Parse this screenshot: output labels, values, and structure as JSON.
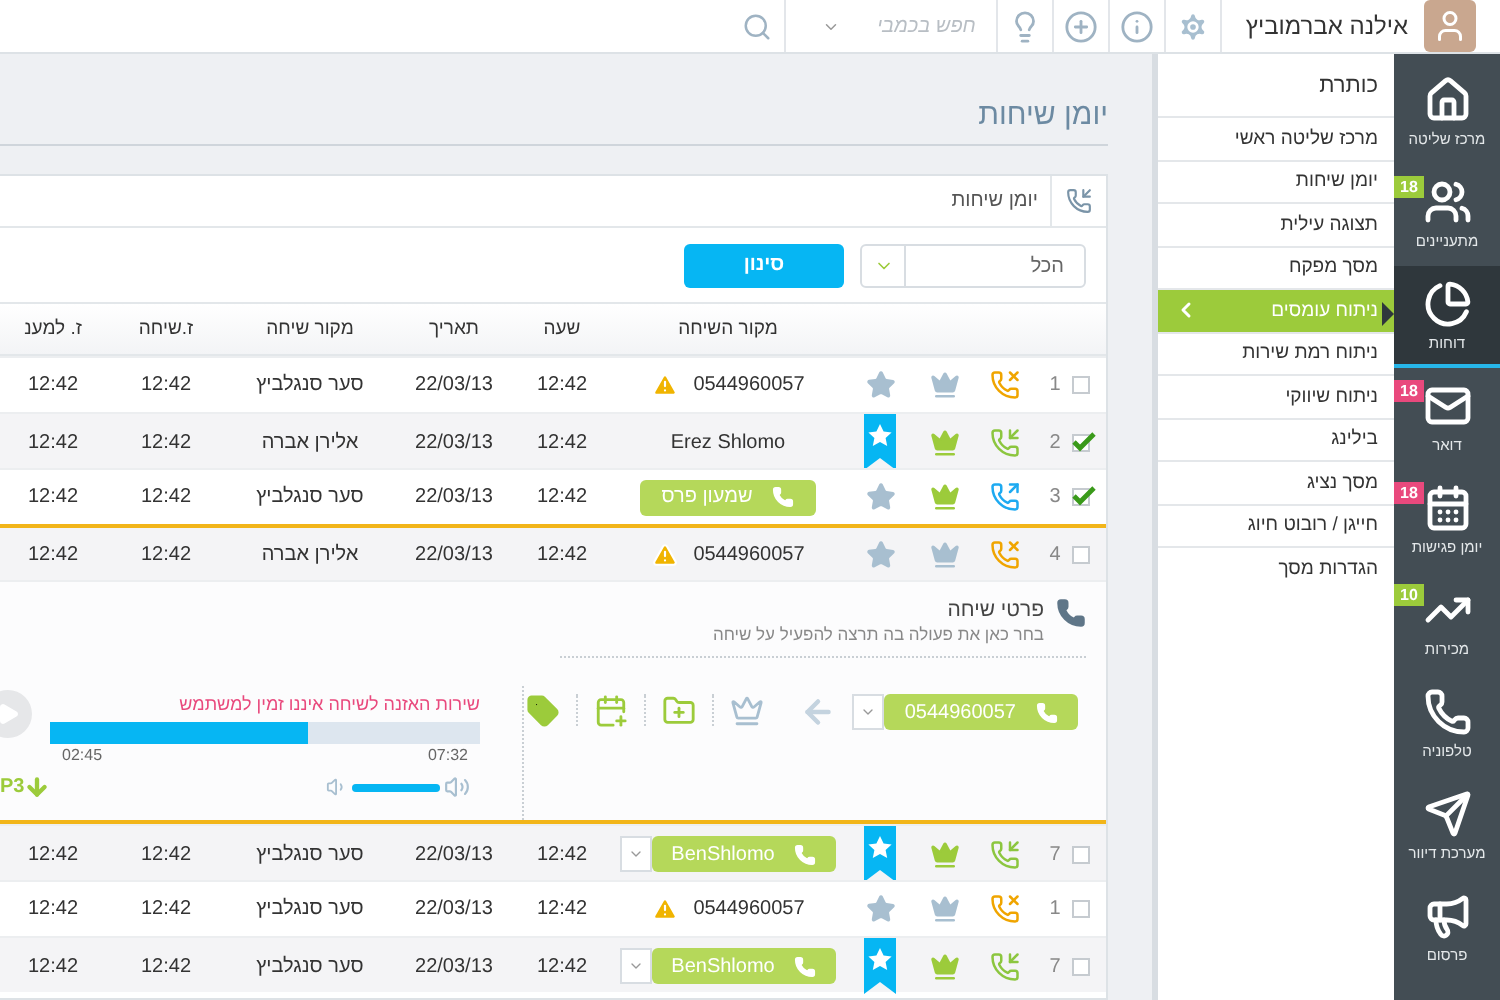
{
  "top_bar": {
    "user_name": "אילנה אברמוביץ",
    "search": {
      "placeholder": "חפש בכמבי"
    }
  },
  "nav": [
    {
      "kind": "home",
      "label": "מרכז שליטה",
      "selected": false
    },
    {
      "kind": "users",
      "label": "מתעניינים",
      "badge": "18",
      "color": "#9ccb3b",
      "selected": false
    },
    {
      "kind": "reports",
      "label": "דוחות",
      "selected": true
    },
    {
      "kind": "mail",
      "label": "דואר",
      "badge": "18",
      "color": "#e9497d",
      "selected": false
    },
    {
      "kind": "calendar",
      "label": "יומן פגישות",
      "badge": "18",
      "color": "#e9497d",
      "selected": false
    },
    {
      "kind": "sales",
      "label": "מכירות",
      "badge": "10",
      "color": "#9ccb3b",
      "selected": false
    },
    {
      "kind": "phone",
      "label": "טלפוניה",
      "selected": false
    },
    {
      "kind": "mailing",
      "label": "מערכת דיוור",
      "selected": false
    },
    {
      "kind": "ads",
      "label": "פרסום",
      "selected": false
    }
  ],
  "submenu": {
    "title": "כותרת",
    "items": [
      {
        "label": "מרכז שליטה ראשי",
        "selected": false
      },
      {
        "label": "יומן שיחות",
        "selected": false
      },
      {
        "label": "תצוגה עילית",
        "selected": false
      },
      {
        "label": "מסך מפקח",
        "selected": false
      },
      {
        "label": "ניתוח עומסים",
        "selected": true
      },
      {
        "label": "ניתוח רמת שירות",
        "selected": false
      },
      {
        "label": "ניתוח שיווקי",
        "selected": false
      },
      {
        "label": "בילינג",
        "selected": false
      },
      {
        "label": "מסך נציג",
        "selected": false
      },
      {
        "label": "חייגן / רובוט חיוג",
        "selected": false
      },
      {
        "label": "הגדרות מסך",
        "selected": false
      }
    ]
  },
  "page_title": "יומן שיחות",
  "card": {
    "tab": "יומן שיחות",
    "filter": {
      "value": "הכל"
    },
    "filter_button": "סינון"
  },
  "table": {
    "columns": [
      "מקור השיחה",
      "שעה",
      "תאריך",
      "מקור שיחה",
      "ז.שיחה",
      "ז. למענ"
    ],
    "rows": [
      {
        "number": "1",
        "checked": false,
        "call": {
          "kind": "missed"
        },
        "vip": false,
        "starred": false,
        "source": {
          "kind": "phone",
          "text": "0544960057"
        },
        "time": "12:42",
        "date": "22/03/13",
        "origin": "סער סנגלביץ",
        "duration": "12:42",
        "answer_time": "12:42",
        "selected": false
      },
      {
        "number": "2",
        "checked": true,
        "call": {
          "kind": "incoming"
        },
        "vip": true,
        "starred": true,
        "source": {
          "kind": "name",
          "text": "Erez Shlomo"
        },
        "time": "12:42",
        "date": "22/03/13",
        "origin": "אלירן אברה",
        "duration": "12:42",
        "answer_time": "12:42",
        "selected": false
      },
      {
        "number": "3",
        "checked": true,
        "call": {
          "kind": "outgoing"
        },
        "vip": true,
        "starred": false,
        "source": {
          "kind": "contact",
          "text": "שמעון פרס"
        },
        "time": "12:42",
        "date": "22/03/13",
        "origin": "סער סנגלביץ",
        "duration": "12:42",
        "answer_time": "12:42",
        "selected": false
      },
      {
        "number": "4",
        "checked": false,
        "call": {
          "kind": "missed"
        },
        "vip": false,
        "starred": false,
        "source": {
          "kind": "phone",
          "text": "0544960057"
        },
        "time": "12:42",
        "date": "22/03/13",
        "origin": "אלירן אברה",
        "duration": "12:42",
        "answer_time": "12:42",
        "selected": true
      }
    ],
    "details": {
      "title": "פרטי שיחה",
      "subtitle": "בחר כאן את פעולה בה תרצה להפעיל על שיחה",
      "phone": "0544960057",
      "notice": "שירות האזנה לשיחה איננו זמין למשתמש",
      "level": 0.6,
      "elapsed": "02:45",
      "total": "07:32",
      "download": "P3",
      "volume": {
        "level": 1
      }
    },
    "more_rows": [
      {
        "number": "7",
        "checked": false,
        "call": {
          "kind": "incoming"
        },
        "vip": true,
        "starred": true,
        "source": {
          "kind": "contact_menu",
          "text": "BenShlomo"
        },
        "time": "12:42",
        "date": "22/03/13",
        "origin": "סער סנגלביץ",
        "duration": "12:42",
        "answer_time": "12:42",
        "selected": false
      },
      {
        "number": "1",
        "checked": false,
        "call": {
          "kind": "missed"
        },
        "vip": false,
        "starred": false,
        "source": {
          "kind": "phone",
          "text": "0544960057"
        },
        "time": "12:42",
        "date": "22/03/13",
        "origin": "סער סנגלביץ",
        "duration": "12:42",
        "answer_time": "12:42",
        "selected": false
      },
      {
        "number": "7",
        "checked": false,
        "call": {
          "kind": "incoming"
        },
        "vip": true,
        "starred": true,
        "source": {
          "kind": "contact_menu",
          "text": "BenShlomo"
        },
        "time": "12:42",
        "date": "22/03/13",
        "origin": "סער סנגלביץ",
        "duration": "12:42",
        "answer_time": "12:42",
        "selected": false
      }
    ]
  }
}
